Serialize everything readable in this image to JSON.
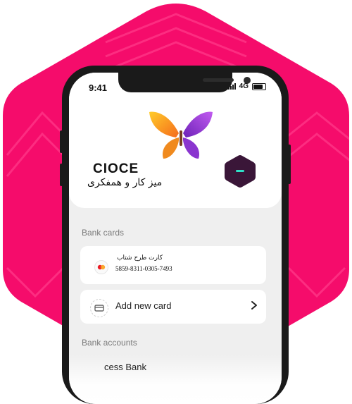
{
  "colors": {
    "brand_pink": "#f50c6b",
    "hex_button": "#3a1638",
    "hex_button_accent": "#2fe0c8",
    "logo_orange": "#f7a21b",
    "logo_purple": "#9a3fe0"
  },
  "status_bar": {
    "time": "9:41",
    "network": "4G"
  },
  "header": {
    "brand_latin": "CIOCE",
    "brand_persian": "میز کار و همفکری",
    "logo_icon": "butterfly-logo",
    "action_icon": "minus-icon"
  },
  "bank_cards": {
    "title": "Bank cards",
    "cards": [
      {
        "name": "کارت طرح شتاب",
        "number": "5859-8311-0305-7493",
        "icon": "mastercard-icon"
      }
    ],
    "add_label": "Add new card"
  },
  "bank_accounts": {
    "title": "Bank accounts",
    "first_item": "cess Bank"
  }
}
